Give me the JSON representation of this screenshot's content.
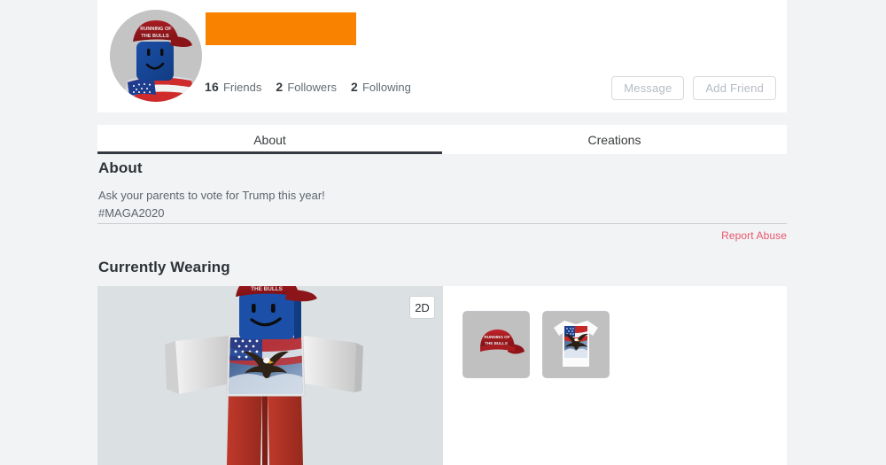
{
  "profile": {
    "username_redacted": true,
    "redaction_color": "#F98200",
    "avatar_alt": "roblox-avatar-headshot",
    "stats": [
      {
        "count": "16",
        "label": "Friends"
      },
      {
        "count": "2",
        "label": "Followers"
      },
      {
        "count": "2",
        "label": "Following"
      }
    ],
    "actions": [
      {
        "label": "Message",
        "name": "message-button"
      },
      {
        "label": "Add Friend",
        "name": "add-friend-button"
      }
    ]
  },
  "tabs": [
    {
      "label": "About",
      "active": true
    },
    {
      "label": "Creations",
      "active": false
    }
  ],
  "about": {
    "heading": "About",
    "description_line1": "Ask your parents to vote for Trump this year!",
    "description_line2": "#MAGA2020",
    "report_abuse_label": "Report Abuse",
    "report_abuse_color": "#e8566a"
  },
  "currently_wearing": {
    "heading": "Currently Wearing",
    "view_toggle_label": "2D",
    "viewport_bg": "#dbe0e3",
    "items": [
      {
        "name": "running-of-the-bulls-cap",
        "type": "hat",
        "caption_line1": "RUNNING OF",
        "caption_line2": "THE BULLS"
      },
      {
        "name": "american-flag-eagle-shirt",
        "type": "shirt",
        "caption_line1": "",
        "caption_line2": ""
      }
    ]
  },
  "theme": {
    "page_bg": "#f2f3f5",
    "card_bg": "#ffffff",
    "text_dark": "#2e3338",
    "text_muted": "#626b73",
    "tab_underline": "#343a40",
    "button_border": "#d6dadd",
    "button_text": "#b5bbc1"
  }
}
